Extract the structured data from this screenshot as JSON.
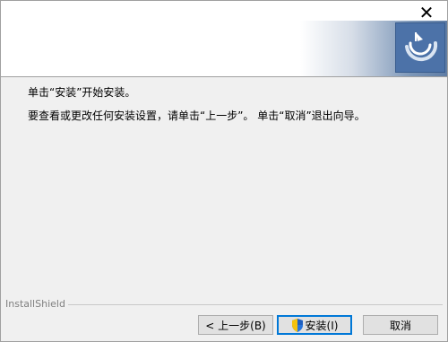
{
  "window": {
    "close_glyph": "✕"
  },
  "message": {
    "line1": "单击“安装”开始安装。",
    "line2": "要查看或更改任何安装设置，请单击“上一步”。 单击“取消”退出向导。"
  },
  "footer": {
    "brand": "InstallShield"
  },
  "buttons": {
    "back": "< 上一步(B)",
    "install": "安装(I)",
    "cancel": "取消"
  },
  "icons": {
    "logo": "installshield-logo-icon",
    "shield": "uac-shield-icon"
  },
  "colors": {
    "accent": "#0078d7",
    "logo_blue": "#4c72a8"
  }
}
